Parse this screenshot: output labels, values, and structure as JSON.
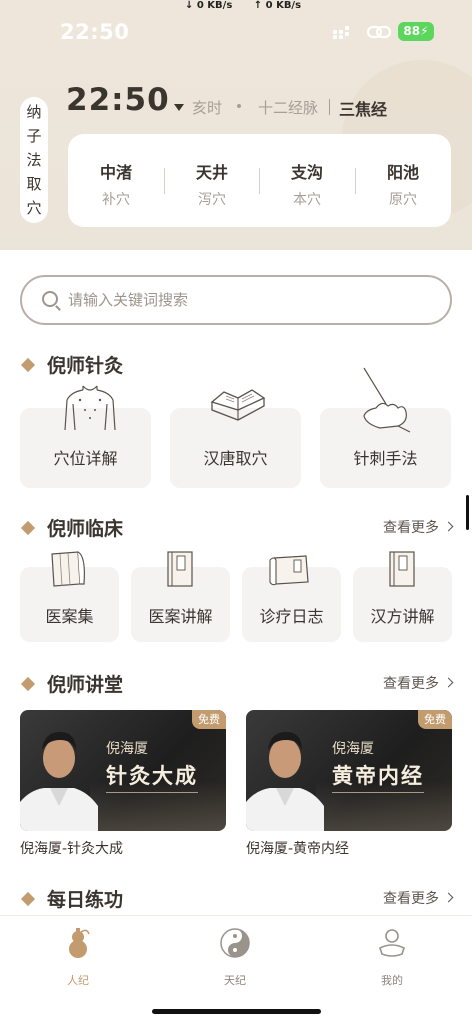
{
  "status_bar": {
    "time": "22:50",
    "net_down": "↓ 0 KB/s",
    "net_up": "↑ 0 KB/s",
    "battery": "88"
  },
  "header": {
    "nazi_label": [
      "纳",
      "子",
      "法",
      "取",
      "穴"
    ],
    "clock": "22:50",
    "shichen": "亥时",
    "system": "十二经脉",
    "meridian": "三焦经",
    "acupoints": [
      {
        "name": "中渚",
        "type": "补穴"
      },
      {
        "name": "天井",
        "type": "泻穴"
      },
      {
        "name": "支沟",
        "type": "本穴"
      },
      {
        "name": "阳池",
        "type": "原穴"
      }
    ]
  },
  "search": {
    "placeholder": "请输入关键词搜索"
  },
  "sections": {
    "acupuncture": {
      "title": "倪师针灸",
      "items": [
        "穴位详解",
        "汉唐取穴",
        "针刺手法"
      ]
    },
    "clinical": {
      "title": "倪师临床",
      "more": "查看更多",
      "items": [
        "医案集",
        "医案讲解",
        "诊疗日志",
        "汉方讲解"
      ]
    },
    "lecture": {
      "title": "倪师讲堂",
      "more": "查看更多",
      "courses": [
        {
          "badge": "免费",
          "teacher": "倪海厦",
          "name": "针灸大成",
          "caption": "倪海厦-针灸大成"
        },
        {
          "badge": "免费",
          "teacher": "倪海厦",
          "name": "黄帝内经",
          "caption": "倪海厦-黄帝内经"
        }
      ]
    },
    "practice": {
      "title": "每日练功",
      "more": "查看更多"
    }
  },
  "tabs": [
    {
      "label": "人纪",
      "icon": "gourd-icon",
      "active": true
    },
    {
      "label": "天纪",
      "icon": "taiji-icon",
      "active": false
    },
    {
      "label": "我的",
      "icon": "profile-icon",
      "active": false
    }
  ],
  "colors": {
    "accent": "#c29b6e",
    "text": "#3b3530",
    "muted": "#a69f97",
    "header_bg": "#ece5da"
  }
}
